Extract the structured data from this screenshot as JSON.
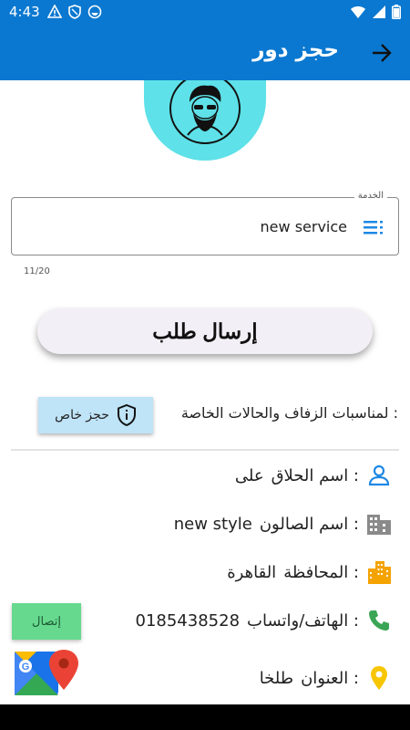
{
  "status_bar": {
    "time": "4:43"
  },
  "app_bar": {
    "title": "حجز دور"
  },
  "service_field": {
    "label": "الخدمة",
    "value": "new service",
    "counter": "11/20"
  },
  "send_button": {
    "label": "إرسال طلب"
  },
  "private": {
    "text": "لمناسبات الزفاف والحالات الخاصة :",
    "button_label": "حجز خاص"
  },
  "info": {
    "barber": {
      "label": "اسم الحلاق :",
      "value": "على"
    },
    "salon": {
      "label": "اسم الصالون :",
      "value": "new style"
    },
    "governorate": {
      "label": "المحافظة :",
      "value": "القاهرة"
    },
    "phone": {
      "label": "الهاتف/واتساب :",
      "value": "0185438528"
    },
    "address": {
      "label": "العنوان :",
      "value": "طلخا"
    }
  },
  "call_button": {
    "label": "إتصال"
  },
  "colors": {
    "primary": "#0a78d0",
    "logo_bg": "#5ee1e8",
    "private_button": "#bfe3f7",
    "call_button": "#66d98e",
    "info_icon_blue": "#1e88e5",
    "building_icon": "#f4a300",
    "phone_icon": "#3aa655",
    "pin_icon": "#f7c600"
  },
  "icons": {
    "status": [
      "warning-icon",
      "shield-icon",
      "sync-icon",
      "wifi-icon",
      "signal-icon",
      "battery-icon"
    ],
    "back": "arrow-right-icon",
    "service": "list-icon",
    "private": "shield-info-icon",
    "barber": "person-icon",
    "salon": "building-icon",
    "governorate": "city-icon",
    "phone": "phone-icon",
    "address": "location-pin-icon",
    "maps": "google-maps-icon"
  }
}
